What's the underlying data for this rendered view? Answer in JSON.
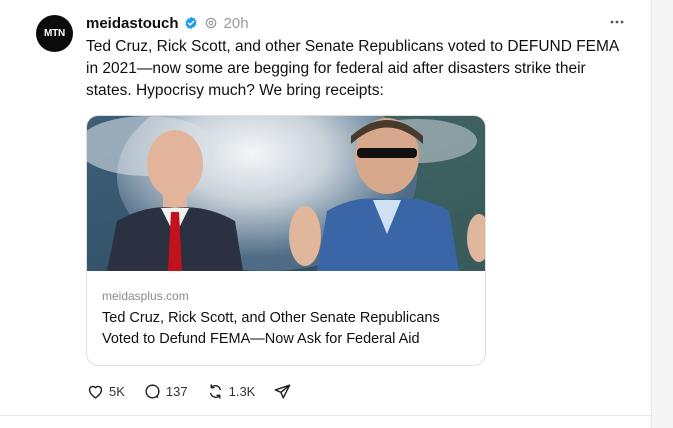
{
  "post": {
    "avatar_text": "MTN",
    "username": "meidastouch",
    "time": "20h",
    "text": "Ted Cruz, Rick Scott, and other Senate Republicans voted to DEFUND FEMA in 2021—now some are begging for federal aid after disasters strike their states. Hypocrisy much? We bring receipts:",
    "link_card": {
      "domain": "meidasplus.com",
      "title": "Ted Cruz, Rick Scott, and Other Senate Republicans Voted to Defund FEMA—Now Ask for Federal Aid"
    },
    "actions": {
      "likes": "5K",
      "replies": "137",
      "reposts": "1.3K"
    }
  },
  "colors": {
    "verified": "#1d9bf0",
    "muted_text": "#9a9a9a",
    "text": "#101010"
  },
  "icons": [
    "verified-badge-icon",
    "sync-icon",
    "more-icon",
    "heart-icon",
    "comment-icon",
    "repost-icon",
    "share-icon"
  ]
}
